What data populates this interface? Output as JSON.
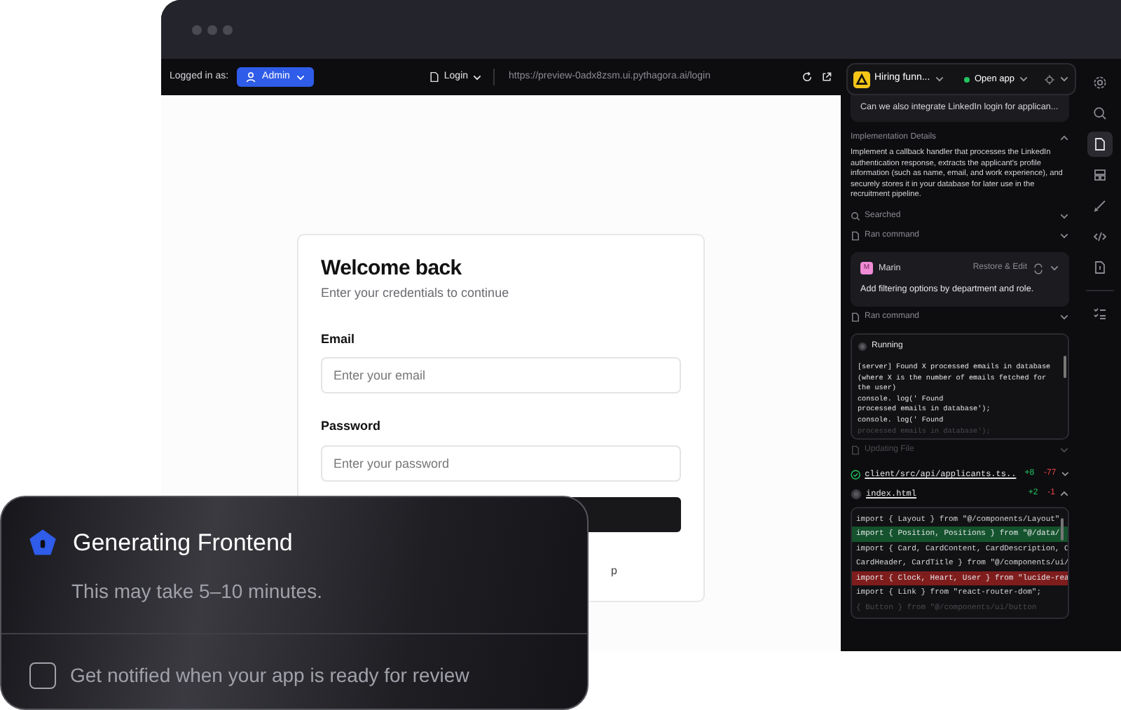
{
  "toolbar": {
    "logged_in_label": "Logged in as:",
    "user_button": "Admin",
    "page_selector": "Login",
    "url": "https://preview-0adx8zsm.ui.pythagora.ai/login"
  },
  "login_card": {
    "title": "Welcome back",
    "subtitle": "Enter your credentials to continue",
    "fields": [
      {
        "label": "Email",
        "placeholder": "Enter your email"
      },
      {
        "label": "Password",
        "placeholder": "Enter your password"
      }
    ],
    "footer_fragment": "p"
  },
  "panel": {
    "project": "Hiring funn...",
    "open_app": "Open app",
    "items": [
      {
        "kind": "message",
        "text": "Can we also integrate LinkedIn login for applican..."
      },
      {
        "kind": "heading",
        "text": "Implementation Details",
        "expanded": true
      },
      {
        "kind": "paragraph",
        "text": "Implement a callback handler that processes the LinkedIn authentication response, extracts the applicant's profile information (such as name, email, and work experience), and securely stores it in your database for later use in the recruitment pipeline."
      },
      {
        "kind": "search_step",
        "text": "Searched",
        "dimmed": false
      },
      {
        "kind": "command_step",
        "text": "Ran command",
        "dimmed": false
      },
      {
        "kind": "user_message",
        "avatar": "M",
        "author": "Marin",
        "action": "Restore & Edit",
        "text": "Add filtering options by department and role."
      },
      {
        "kind": "command_step",
        "text": "Ran command",
        "dimmed": false
      },
      {
        "kind": "terminal",
        "status": "Running",
        "lines": [
          "[server] Found X processed emails in database",
          "(where X is the number of emails fetched for",
          "the user)",
          "console. log(' Found",
          "processed emails in database');",
          "console. log(' Found",
          "processed emails in database');"
        ]
      },
      {
        "kind": "command_step",
        "text": "Updating File",
        "dimmed": true
      },
      {
        "kind": "file",
        "path": "client/src/api/applicants.ts..",
        "added": "+8",
        "removed": "-77",
        "done": true,
        "expanded": false
      },
      {
        "kind": "file",
        "path": "index.html",
        "added": "+2",
        "removed": "-1",
        "done": false,
        "expanded": true
      },
      {
        "kind": "diff",
        "lines": [
          {
            "kind": "context",
            "text": "import { Layout } from \"@/components/Layout\""
          },
          {
            "kind": "added",
            "text": "import { Position, Positions } from \"@/data/"
          },
          {
            "kind": "context",
            "text": "import { Card, CardContent, CardDescription, C"
          },
          {
            "kind": "context",
            "text": "CardHeader, CardTitle } from \"@/components/ui/"
          },
          {
            "kind": "removed",
            "text": "import { Clock, Heart, User } from \"lucide-rea"
          },
          {
            "kind": "context",
            "text": "import { Link } from \"react-router-dom\";"
          },
          {
            "kind": "faded",
            "text": "{ Button } from \"@/components/ui/button"
          }
        ]
      }
    ]
  },
  "rail": [
    {
      "selected": false
    },
    {
      "selected": false
    },
    {
      "selected": true
    },
    {
      "selected": false
    },
    {
      "selected": false
    },
    {
      "selected": false
    },
    {
      "selected": false
    },
    {
      "selected": false
    }
  ],
  "notification": {
    "title": "Generating Frontend",
    "subtitle": "This may take 5–10 minutes.",
    "checkbox": {
      "label": "Get notified when your app is ready for review",
      "checked": false
    }
  }
}
